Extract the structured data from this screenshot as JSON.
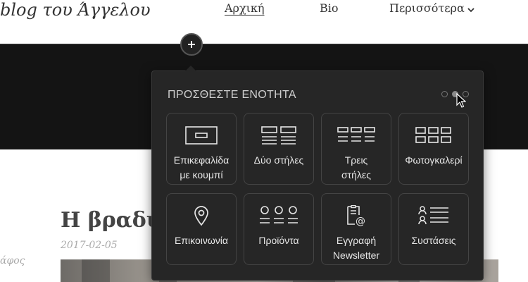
{
  "header": {
    "site_title": "blog του Άγγελου",
    "nav": {
      "home": "Αρχική",
      "bio": "Bio",
      "more": "Περισσότερα"
    }
  },
  "article": {
    "title": "Η βραδιά",
    "date": "2017-02-05",
    "side_text": "άφος"
  },
  "popover": {
    "title": "ΠΡΟΣΘΕΣΤΕ ΕΝΟΤΗΤΑ",
    "pages": 3,
    "active_page": 2,
    "tiles": [
      {
        "label_line1": "Επικεφαλίδα",
        "label_line2": "με κουμπί",
        "icon": "header-with-button-icon"
      },
      {
        "label_line1": "Δύο στήλες",
        "label_line2": "",
        "icon": "two-columns-icon"
      },
      {
        "label_line1": "Τρεις",
        "label_line2": "στήλες",
        "icon": "three-columns-icon"
      },
      {
        "label_line1": "Φωτογκαλερί",
        "label_line2": "",
        "icon": "photo-gallery-icon"
      },
      {
        "label_line1": "Επικοινωνία",
        "label_line2": "",
        "icon": "location-pin-icon"
      },
      {
        "label_line1": "Προϊόντα",
        "label_line2": "",
        "icon": "products-icon"
      },
      {
        "label_line1": "Εγγραφή",
        "label_line2": "Newsletter",
        "icon": "newsletter-icon"
      },
      {
        "label_line1": "Συστάσεις",
        "label_line2": "",
        "icon": "testimonials-icon"
      }
    ]
  },
  "colors": {
    "hero_bg": "#141414",
    "popover_bg": "#262626",
    "tile_border": "#444444",
    "text_light": "#e6e6e6"
  }
}
